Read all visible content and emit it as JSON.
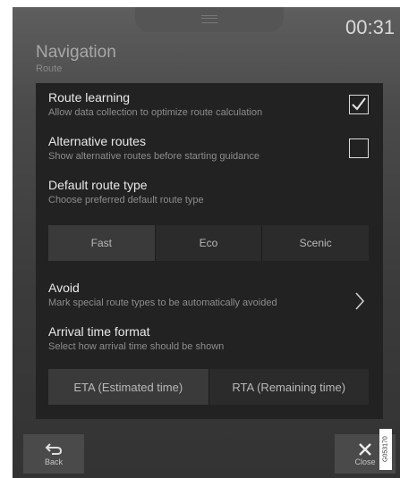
{
  "status": {
    "time": "00:31"
  },
  "header": {
    "title": "Navigation",
    "subtitle": "Route"
  },
  "settings": {
    "route_learning": {
      "title": "Route learning",
      "description": "Allow data collection to optimize route calculation",
      "checked": true
    },
    "alternative_routes": {
      "title": "Alternative routes",
      "description": "Show alternative routes before starting guidance",
      "checked": false
    },
    "default_route_type": {
      "title": "Default route type",
      "description": "Choose preferred default route type",
      "options": [
        "Fast",
        "Eco",
        "Scenic"
      ],
      "selected": "Fast"
    },
    "avoid": {
      "title": "Avoid",
      "description": "Mark special route types to be automatically avoided"
    },
    "arrival_time_format": {
      "title": "Arrival time format",
      "description": "Select how arrival time should be shown",
      "options": [
        "ETA (Estimated time)",
        "RTA (Remaining time)"
      ],
      "selected": "ETA (Estimated time)"
    }
  },
  "footer": {
    "back_label": "Back",
    "close_label": "Close"
  },
  "reference_code": "G053170",
  "icons": {
    "checkbox_checked": "checkmark-icon",
    "avoid_arrow": "chevron-right-icon",
    "back": "back-arrow-icon",
    "close": "close-icon"
  }
}
